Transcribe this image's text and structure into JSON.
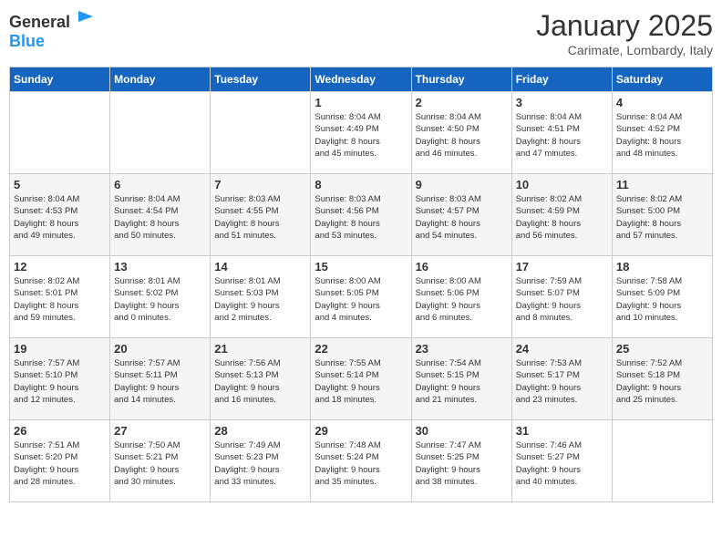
{
  "logo": {
    "general": "General",
    "blue": "Blue"
  },
  "title": "January 2025",
  "location": "Carimate, Lombardy, Italy",
  "days_of_week": [
    "Sunday",
    "Monday",
    "Tuesday",
    "Wednesday",
    "Thursday",
    "Friday",
    "Saturday"
  ],
  "weeks": [
    [
      {
        "day": "",
        "info": ""
      },
      {
        "day": "",
        "info": ""
      },
      {
        "day": "",
        "info": ""
      },
      {
        "day": "1",
        "info": "Sunrise: 8:04 AM\nSunset: 4:49 PM\nDaylight: 8 hours\nand 45 minutes."
      },
      {
        "day": "2",
        "info": "Sunrise: 8:04 AM\nSunset: 4:50 PM\nDaylight: 8 hours\nand 46 minutes."
      },
      {
        "day": "3",
        "info": "Sunrise: 8:04 AM\nSunset: 4:51 PM\nDaylight: 8 hours\nand 47 minutes."
      },
      {
        "day": "4",
        "info": "Sunrise: 8:04 AM\nSunset: 4:52 PM\nDaylight: 8 hours\nand 48 minutes."
      }
    ],
    [
      {
        "day": "5",
        "info": "Sunrise: 8:04 AM\nSunset: 4:53 PM\nDaylight: 8 hours\nand 49 minutes."
      },
      {
        "day": "6",
        "info": "Sunrise: 8:04 AM\nSunset: 4:54 PM\nDaylight: 8 hours\nand 50 minutes."
      },
      {
        "day": "7",
        "info": "Sunrise: 8:03 AM\nSunset: 4:55 PM\nDaylight: 8 hours\nand 51 minutes."
      },
      {
        "day": "8",
        "info": "Sunrise: 8:03 AM\nSunset: 4:56 PM\nDaylight: 8 hours\nand 53 minutes."
      },
      {
        "day": "9",
        "info": "Sunrise: 8:03 AM\nSunset: 4:57 PM\nDaylight: 8 hours\nand 54 minutes."
      },
      {
        "day": "10",
        "info": "Sunrise: 8:02 AM\nSunset: 4:59 PM\nDaylight: 8 hours\nand 56 minutes."
      },
      {
        "day": "11",
        "info": "Sunrise: 8:02 AM\nSunset: 5:00 PM\nDaylight: 8 hours\nand 57 minutes."
      }
    ],
    [
      {
        "day": "12",
        "info": "Sunrise: 8:02 AM\nSunset: 5:01 PM\nDaylight: 8 hours\nand 59 minutes."
      },
      {
        "day": "13",
        "info": "Sunrise: 8:01 AM\nSunset: 5:02 PM\nDaylight: 9 hours\nand 0 minutes."
      },
      {
        "day": "14",
        "info": "Sunrise: 8:01 AM\nSunset: 5:03 PM\nDaylight: 9 hours\nand 2 minutes."
      },
      {
        "day": "15",
        "info": "Sunrise: 8:00 AM\nSunset: 5:05 PM\nDaylight: 9 hours\nand 4 minutes."
      },
      {
        "day": "16",
        "info": "Sunrise: 8:00 AM\nSunset: 5:06 PM\nDaylight: 9 hours\nand 6 minutes."
      },
      {
        "day": "17",
        "info": "Sunrise: 7:59 AM\nSunset: 5:07 PM\nDaylight: 9 hours\nand 8 minutes."
      },
      {
        "day": "18",
        "info": "Sunrise: 7:58 AM\nSunset: 5:09 PM\nDaylight: 9 hours\nand 10 minutes."
      }
    ],
    [
      {
        "day": "19",
        "info": "Sunrise: 7:57 AM\nSunset: 5:10 PM\nDaylight: 9 hours\nand 12 minutes."
      },
      {
        "day": "20",
        "info": "Sunrise: 7:57 AM\nSunset: 5:11 PM\nDaylight: 9 hours\nand 14 minutes."
      },
      {
        "day": "21",
        "info": "Sunrise: 7:56 AM\nSunset: 5:13 PM\nDaylight: 9 hours\nand 16 minutes."
      },
      {
        "day": "22",
        "info": "Sunrise: 7:55 AM\nSunset: 5:14 PM\nDaylight: 9 hours\nand 18 minutes."
      },
      {
        "day": "23",
        "info": "Sunrise: 7:54 AM\nSunset: 5:15 PM\nDaylight: 9 hours\nand 21 minutes."
      },
      {
        "day": "24",
        "info": "Sunrise: 7:53 AM\nSunset: 5:17 PM\nDaylight: 9 hours\nand 23 minutes."
      },
      {
        "day": "25",
        "info": "Sunrise: 7:52 AM\nSunset: 5:18 PM\nDaylight: 9 hours\nand 25 minutes."
      }
    ],
    [
      {
        "day": "26",
        "info": "Sunrise: 7:51 AM\nSunset: 5:20 PM\nDaylight: 9 hours\nand 28 minutes."
      },
      {
        "day": "27",
        "info": "Sunrise: 7:50 AM\nSunset: 5:21 PM\nDaylight: 9 hours\nand 30 minutes."
      },
      {
        "day": "28",
        "info": "Sunrise: 7:49 AM\nSunset: 5:23 PM\nDaylight: 9 hours\nand 33 minutes."
      },
      {
        "day": "29",
        "info": "Sunrise: 7:48 AM\nSunset: 5:24 PM\nDaylight: 9 hours\nand 35 minutes."
      },
      {
        "day": "30",
        "info": "Sunrise: 7:47 AM\nSunset: 5:25 PM\nDaylight: 9 hours\nand 38 minutes."
      },
      {
        "day": "31",
        "info": "Sunrise: 7:46 AM\nSunset: 5:27 PM\nDaylight: 9 hours\nand 40 minutes."
      },
      {
        "day": "",
        "info": ""
      }
    ]
  ]
}
